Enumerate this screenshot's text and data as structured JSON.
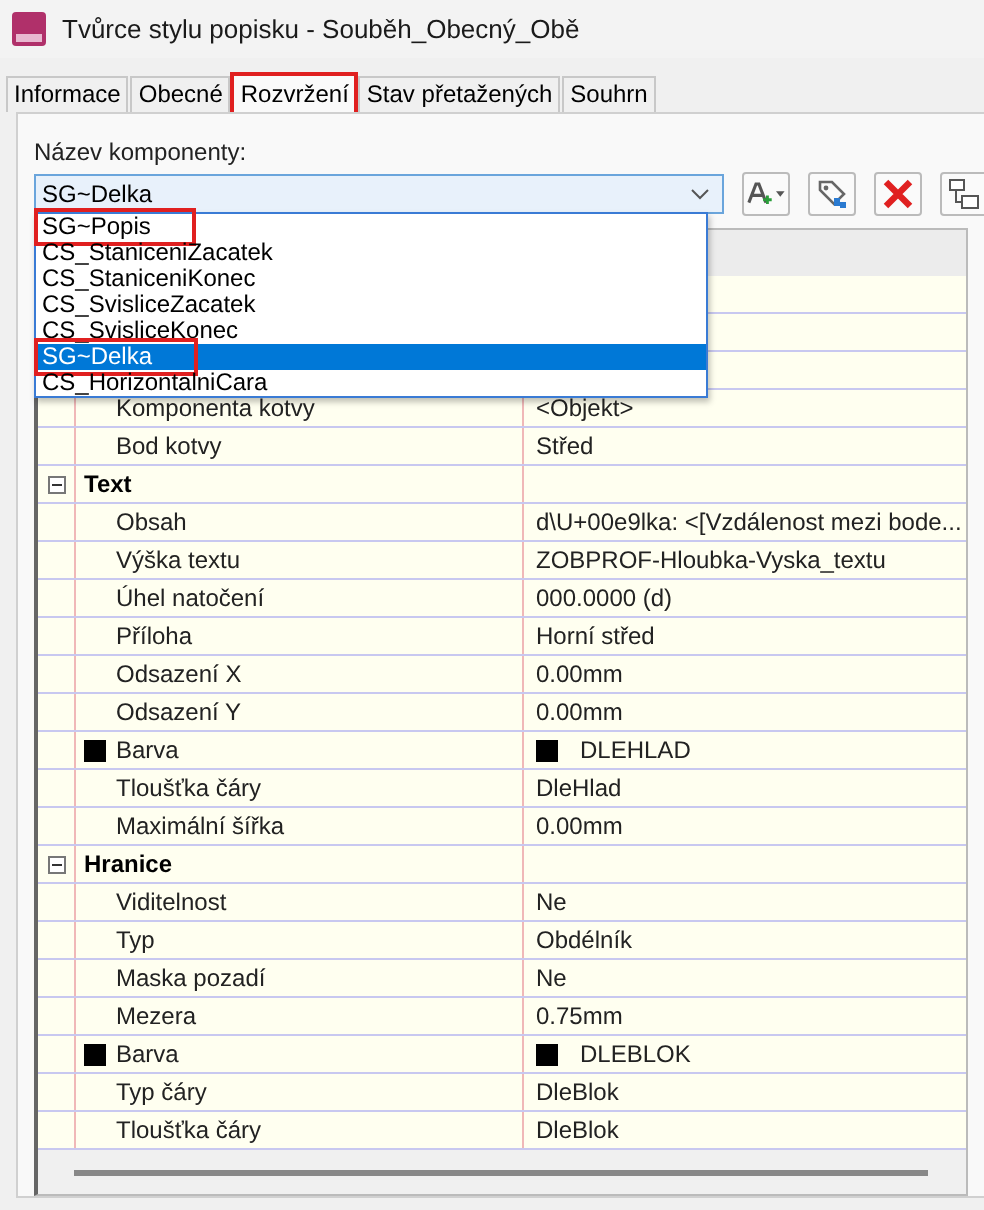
{
  "window": {
    "title": "Tvůrce stylu popisku - Souběh_Obecný_Obě"
  },
  "tabs": [
    {
      "label": "Informace",
      "selected": false,
      "highlighted": false
    },
    {
      "label": "Obecné",
      "selected": false,
      "highlighted": false
    },
    {
      "label": "Rozvržení",
      "selected": true,
      "highlighted": true
    },
    {
      "label": "Stav přetažených",
      "selected": false,
      "highlighted": false
    },
    {
      "label": "Souhrn",
      "selected": false,
      "highlighted": false
    }
  ],
  "component": {
    "label": "Název komponenty:",
    "value": "SG~Delka",
    "expanded": true,
    "options": [
      {
        "label": "SG~Popis",
        "selected": false,
        "highlighted": true
      },
      {
        "label": "CS_StaniceniZacatek",
        "selected": false,
        "highlighted": false
      },
      {
        "label": "CS_StaniceniKonec",
        "selected": false,
        "highlighted": false
      },
      {
        "label": "CS_SvisliceZacatek",
        "selected": false,
        "highlighted": false
      },
      {
        "label": "CS_SvisliceKonec",
        "selected": false,
        "highlighted": false
      },
      {
        "label": "SG~Delka",
        "selected": true,
        "highlighted": true
      },
      {
        "label": "CS_HorizontalniCara",
        "selected": false,
        "highlighted": false
      }
    ]
  },
  "properties": [
    {
      "kind": "hidden"
    },
    {
      "kind": "hidden"
    },
    {
      "kind": "hidden"
    },
    {
      "kind": "property",
      "label": "Komponenta kotvy",
      "value": "<Objekt>"
    },
    {
      "kind": "property",
      "label": "Bod kotvy",
      "value": "Střed"
    },
    {
      "kind": "group",
      "label": "Text",
      "expanded": true
    },
    {
      "kind": "property",
      "label": "Obsah",
      "value": "d\\U+00e9lka: <[Vzdálenost mezi bode..."
    },
    {
      "kind": "property",
      "label": "Výška textu",
      "value": "ZOBPROF-Hloubka-Vyska_textu"
    },
    {
      "kind": "property",
      "label": "Úhel natočení",
      "value": "000.0000 (d)"
    },
    {
      "kind": "property",
      "label": "Příloha",
      "value": "Horní střed"
    },
    {
      "kind": "property",
      "label": "Odsazení X",
      "value": "0.00mm"
    },
    {
      "kind": "property",
      "label": "Odsazení Y",
      "value": "0.00mm"
    },
    {
      "kind": "property",
      "label": "Barva",
      "value": "DLEHLAD",
      "color": "#000000"
    },
    {
      "kind": "property",
      "label": "Tloušťka čáry",
      "value": "DleHlad"
    },
    {
      "kind": "property",
      "label": "Maximální šířka",
      "value": "0.00mm"
    },
    {
      "kind": "group",
      "label": "Hranice",
      "expanded": true
    },
    {
      "kind": "property",
      "label": "Viditelnost",
      "value": "Ne"
    },
    {
      "kind": "property",
      "label": "Typ",
      "value": "Obdélník"
    },
    {
      "kind": "property",
      "label": "Maska pozadí",
      "value": "Ne"
    },
    {
      "kind": "property",
      "label": "Mezera",
      "value": "0.75mm"
    },
    {
      "kind": "property",
      "label": "Barva",
      "value": "DLEBLOK",
      "color": "#000000"
    },
    {
      "kind": "property",
      "label": "Typ čáry",
      "value": "DleBlok"
    },
    {
      "kind": "property",
      "label": "Tloušťka čáry",
      "value": "DleBlok"
    }
  ]
}
